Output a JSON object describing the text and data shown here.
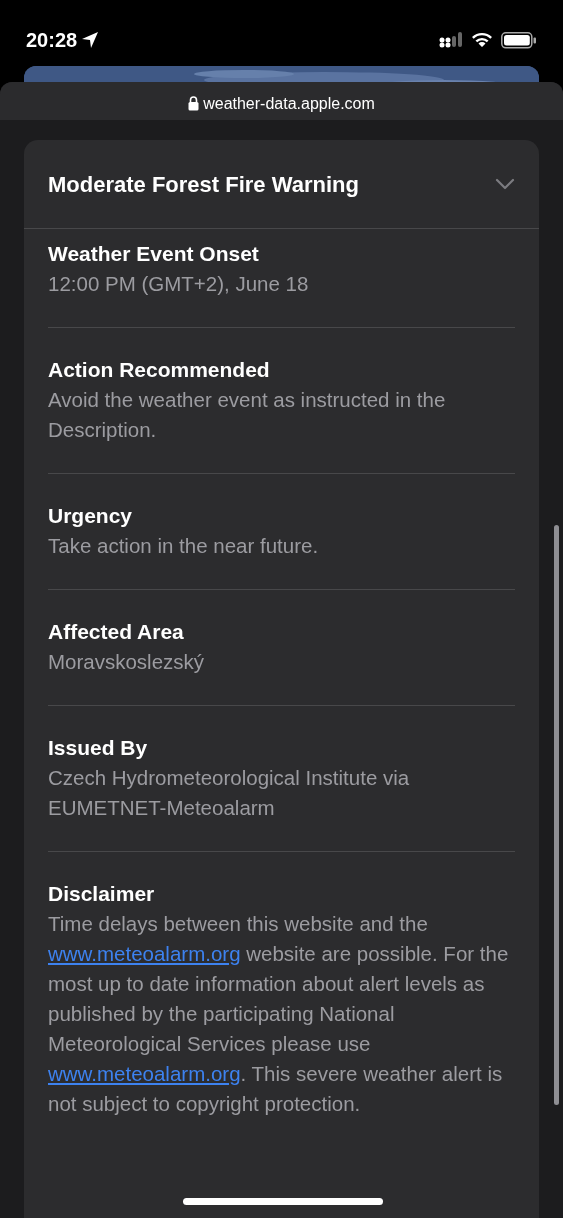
{
  "status_bar": {
    "time": "20:28"
  },
  "browser": {
    "url": "weather-data.apple.com"
  },
  "alert": {
    "title": "Moderate Forest Fire Warning",
    "expanded": false,
    "sections": [
      {
        "heading": "Weather Event Onset",
        "text": "12:00 PM (GMT+2), June 18"
      },
      {
        "heading": "Action Recommended",
        "text": "Avoid the weather event as instructed in the Description."
      },
      {
        "heading": "Urgency",
        "text": "Take action in the near future."
      },
      {
        "heading": "Affected Area",
        "text": "Moravskoslezský"
      },
      {
        "heading": "Issued By",
        "text": "Czech Hydrometeorological Institute via EUMETNET-Meteoalarm"
      }
    ],
    "disclaimer": {
      "heading": "Disclaimer",
      "parts": [
        {
          "kind": "text",
          "text": "Time delays between this website and the "
        },
        {
          "kind": "link",
          "text": "www.meteoalarm.org"
        },
        {
          "kind": "text",
          "text": " website are possible. For the most up to date information about alert levels as published by the participating National Meteorological Services please use "
        },
        {
          "kind": "link",
          "text": "www.meteoalarm.org"
        },
        {
          "kind": "text",
          "text": ". This severe weather alert is not subject to copyright protection."
        }
      ]
    }
  }
}
